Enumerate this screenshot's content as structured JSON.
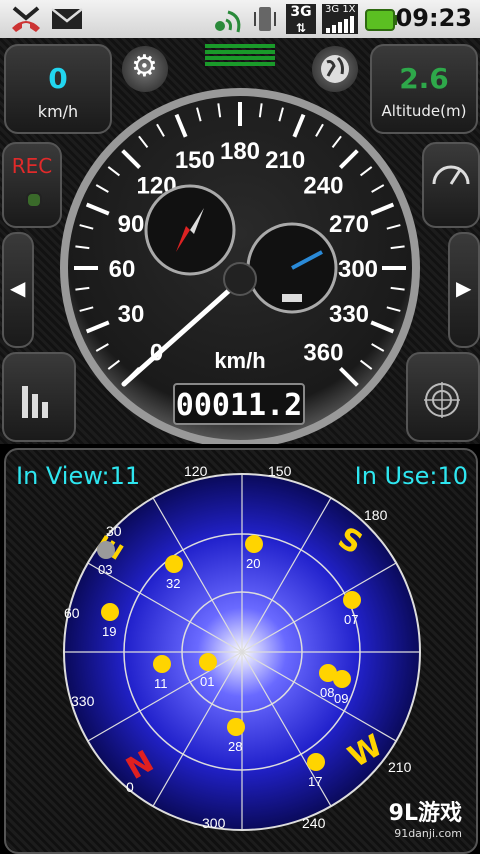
{
  "status_bar": {
    "time": "09:23",
    "icons": [
      "missed-call-icon",
      "email-icon",
      "gps-signal-icon",
      "vibrate-icon",
      "3g-signal-icon",
      "signal-bars-icon",
      "battery-icon"
    ],
    "network_label": "3G",
    "network_sub": "1X"
  },
  "speed_panel": {
    "value": "0",
    "unit": "km/h",
    "color": "#22d6f0"
  },
  "altitude_panel": {
    "value": "2.6",
    "unit": "Altitude(m)",
    "color": "#2ea84a"
  },
  "rec_button": {
    "label": "REC",
    "color": "#e02a2a"
  },
  "speedometer": {
    "unit": "km/h",
    "odometer": "00011.2",
    "speed": 0,
    "scale_labels": [
      "0",
      "30",
      "60",
      "90",
      "120",
      "150",
      "180",
      "210",
      "240",
      "270",
      "300",
      "330",
      "360"
    ],
    "needle_color": "#ffffff"
  },
  "satellite_view": {
    "in_view_label": "In View:11",
    "in_use_label": "In Use:10",
    "compass": {
      "N": "N",
      "E": "E",
      "S": "S",
      "W": "W"
    },
    "bearing_labels": [
      "0",
      "30",
      "60",
      "120",
      "150",
      "180",
      "210",
      "240",
      "300",
      "330"
    ],
    "satellites": [
      {
        "id": "03",
        "color": "#9a9a9a"
      },
      {
        "id": "32",
        "color": "#ffd400"
      },
      {
        "id": "20",
        "color": "#ffd400"
      },
      {
        "id": "19",
        "color": "#ffd400"
      },
      {
        "id": "11",
        "color": "#ffd400"
      },
      {
        "id": "01",
        "color": "#ffd400"
      },
      {
        "id": "07",
        "color": "#ffd400"
      },
      {
        "id": "08",
        "color": "#ffd400"
      },
      {
        "id": "09",
        "color": "#ffd400"
      },
      {
        "id": "28",
        "color": "#ffd400"
      },
      {
        "id": "17",
        "color": "#ffd400"
      }
    ]
  },
  "watermark": {
    "brand": "9L游戏",
    "site": "91danji.com"
  }
}
